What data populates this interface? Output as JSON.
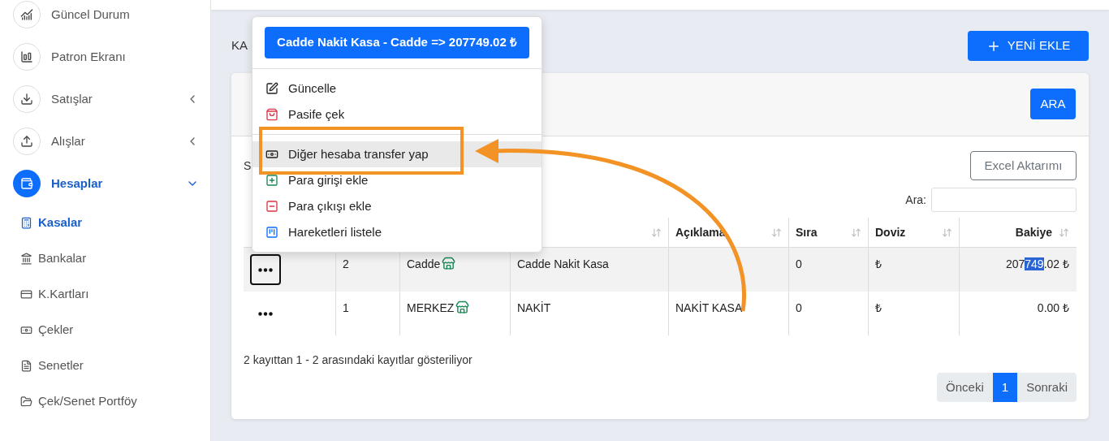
{
  "sidebar": {
    "items": [
      {
        "label": "Güncel Durum",
        "selected": false
      },
      {
        "label": "Patron Ekranı",
        "selected": false
      },
      {
        "label": "Satışlar",
        "selected": false,
        "expanded": false
      },
      {
        "label": "Alışlar",
        "selected": false,
        "expanded": false
      },
      {
        "label": "Hesaplar",
        "selected": true,
        "expanded": true,
        "children": [
          {
            "label": "Kasalar",
            "selected": true
          },
          {
            "label": "Bankalar",
            "selected": false
          },
          {
            "label": "K.Kartları",
            "selected": false
          },
          {
            "label": "Çekler",
            "selected": false
          },
          {
            "label": "Senetler",
            "selected": false
          },
          {
            "label": "Çek/Senet Portföy",
            "selected": false
          }
        ]
      }
    ]
  },
  "page_title": "KA",
  "add_button": "YENİ EKLE",
  "filter": {
    "search_button": "ARA"
  },
  "toolbar": {
    "label": "S",
    "export_button": "Excel Aktarımı",
    "search_label": "Ara:"
  },
  "table": {
    "columns": [
      {
        "sortable": true
      },
      {
        "label": "Açıklama",
        "sortable": true
      },
      {
        "label": "Sıra",
        "sortable": true
      },
      {
        "label": "Doviz",
        "sortable": true
      },
      {
        "label": "Bakiye",
        "sortable": true
      }
    ],
    "rows": [
      {
        "selected": true,
        "no": "2",
        "branch": "Cadde",
        "name": "Cadde Nakit Kasa",
        "description": "",
        "order": "0",
        "currency": "₺",
        "balance": [
          {
            "text": "207",
            "highlighted": false
          },
          {
            "text": "749",
            "highlighted": true
          },
          {
            "text": ".02 ₺",
            "highlighted": false
          }
        ]
      },
      {
        "selected": false,
        "no": "1",
        "branch": "MERKEZ",
        "name": "NAKİT",
        "description": "NAKİT KASA",
        "order": "0",
        "currency": "₺",
        "balance": [
          {
            "text": "0.00 ₺",
            "highlighted": false
          }
        ]
      }
    ]
  },
  "info": "2 kayıttan 1 - 2 arasındaki kayıtlar gösteriliyor",
  "pagination": [
    {
      "label": "Önceki",
      "selected": false
    },
    {
      "label": "1",
      "selected": true
    },
    {
      "label": "Sonraki",
      "selected": false
    }
  ],
  "context_menu": {
    "header": "Cadde Nakit Kasa - Cadde => 207749.02 ₺",
    "groups": [
      [
        {
          "label": "Güncelle",
          "selected": false
        },
        {
          "label": "Pasife çek",
          "selected": false
        }
      ],
      [
        {
          "label": "Diğer hesaba transfer yap",
          "selected": true
        },
        {
          "label": "Para girişi ekle",
          "selected": false
        },
        {
          "label": "Para çıkışı ekle",
          "selected": false
        },
        {
          "label": "Hareketleri listele",
          "selected": false
        }
      ]
    ]
  }
}
